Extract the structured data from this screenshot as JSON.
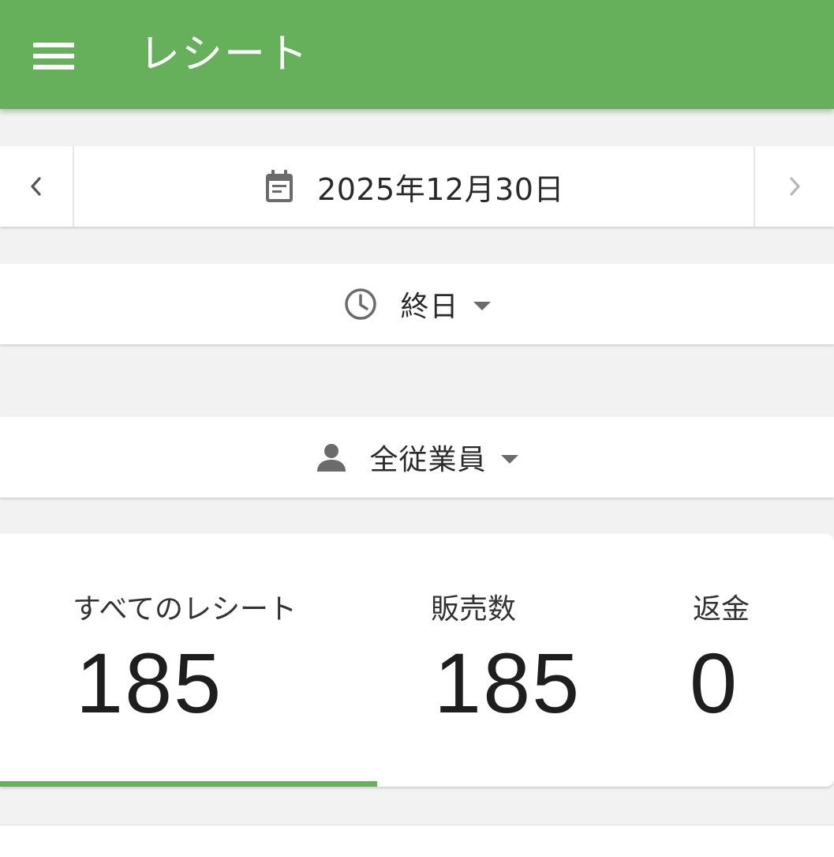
{
  "appbar": {
    "title": "レシート",
    "menu_icon": "hamburger-menu-icon",
    "color": "#66af5b"
  },
  "date_selector": {
    "prev_icon": "chevron-left-icon",
    "next_icon": "chevron-right-icon",
    "calendar_icon": "calendar-icon",
    "date": "2025年12月30日"
  },
  "time_filter": {
    "icon": "clock-icon",
    "value": "終日",
    "dropdown_icon": "caret-down-icon"
  },
  "employee_filter": {
    "icon": "person-icon",
    "value": "全従業員",
    "dropdown_icon": "caret-down-icon"
  },
  "stats": [
    {
      "label": "すべてのレシート",
      "value": "185",
      "selected": true
    },
    {
      "label": "販売数",
      "value": "185",
      "selected": false
    },
    {
      "label": "返金",
      "value": "0",
      "selected": false
    }
  ]
}
